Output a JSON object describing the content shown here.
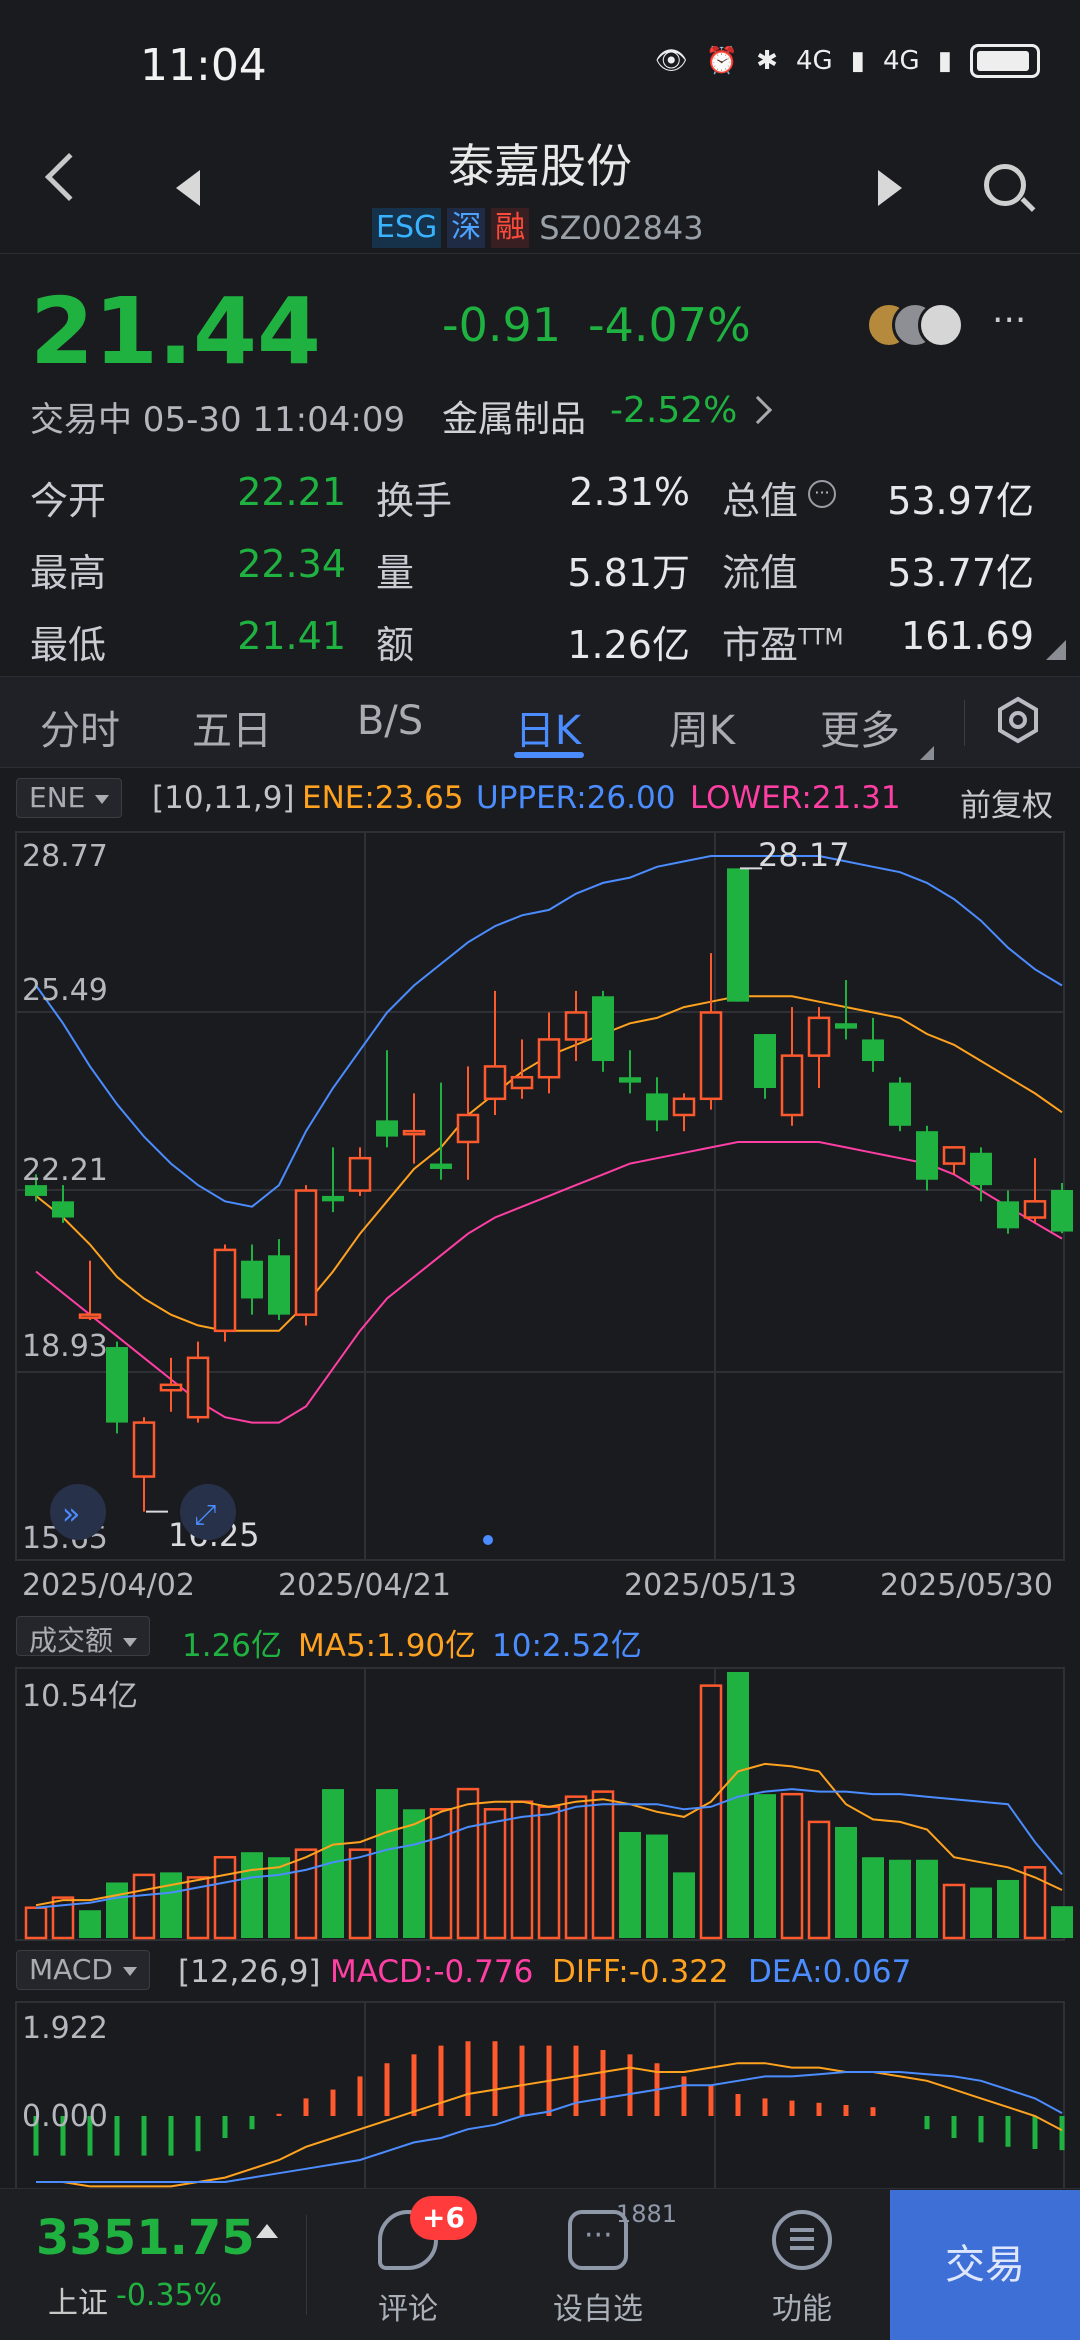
{
  "status_bar": {
    "time": "11:04",
    "net1": "4G",
    "net2": "4G"
  },
  "header": {
    "title": "泰嘉股份",
    "badges": [
      "ESG",
      "深",
      "融"
    ],
    "code": "SZ002843"
  },
  "quote": {
    "price": "21.44",
    "change": "-0.91",
    "change_pct": "-4.07%",
    "status": "交易中 05-30 11:04:09",
    "industry": "金属制品",
    "industry_change": "-2.52%",
    "more": "···"
  },
  "stats": [
    [
      {
        "label": "今开",
        "value": "22.21"
      },
      {
        "label": "换手",
        "value": "2.31%"
      },
      {
        "label": "总值",
        "value": "53.97亿"
      }
    ],
    [
      {
        "label": "最高",
        "value": "22.34"
      },
      {
        "label": "量",
        "value": "5.81万"
      },
      {
        "label": "流值",
        "value": "53.77亿"
      }
    ],
    [
      {
        "label": "最低",
        "value": "21.41"
      },
      {
        "label": "额",
        "value": "1.26亿"
      },
      {
        "label": "市盈",
        "value": "161.69",
        "sup": "TTM"
      }
    ]
  ],
  "tabs": [
    "分时",
    "五日",
    "B/S",
    "日K",
    "周K",
    "更多"
  ],
  "active_tab": "日K",
  "kline": {
    "indicator_select": "ENE",
    "params": "[10,11,9]",
    "ene": "ENE:23.65",
    "upper": "UPPER:26.00",
    "lower": "LOWER:21.31",
    "adjust": "前复权",
    "y_labels": [
      "28.77",
      "25.49",
      "22.21",
      "18.93",
      "15.65"
    ],
    "high_label": "28.17",
    "low_label": "16.25",
    "dates": [
      "2025/04/02",
      "2025/04/21",
      "2025/05/13",
      "2025/05/30"
    ]
  },
  "volume": {
    "select": "成交额",
    "value": "1.26亿",
    "ma5": "MA5:1.90亿",
    "ma10": "10:2.52亿",
    "y_max": "10.54亿"
  },
  "macd": {
    "select": "MACD",
    "params": "[12,26,9]",
    "macd": "MACD:-0.776",
    "diff": "DIFF:-0.322",
    "dea": "DEA:0.067",
    "y_labels": [
      "1.922",
      "0.000"
    ]
  },
  "bottom": {
    "index_value": "3351.75",
    "index_name": "上证",
    "index_change": "-0.35%",
    "comments_badge": "+6",
    "comments": "评论",
    "favorite_count": "1881",
    "favorite": "设自选",
    "functions": "功能",
    "trade": "交易"
  },
  "colors": {
    "up": "#ff5a2d",
    "down": "#20b241",
    "ene": "#ffa21f",
    "upper": "#4b8cff",
    "lower": "#ff3fa4",
    "accent": "#4b8cff"
  },
  "chart_data": [
    {
      "type": "candlestick",
      "title": "日K",
      "dates_shown": [
        "2025/04/02",
        "2025/04/21",
        "2025/05/13",
        "2025/05/30"
      ],
      "ylim": [
        15.65,
        28.77
      ],
      "candles": [
        {
          "o": 22.3,
          "c": 22.1,
          "h": 22.5,
          "l": 22.0
        },
        {
          "o": 22.0,
          "c": 21.7,
          "h": 22.3,
          "l": 21.6
        },
        {
          "o": 19.9,
          "c": 19.9,
          "h": 20.9,
          "l": 19.8
        },
        {
          "o": 19.3,
          "c": 17.9,
          "h": 19.4,
          "l": 17.7
        },
        {
          "o": 16.9,
          "c": 17.9,
          "h": 18.0,
          "l": 16.25
        },
        {
          "o": 18.5,
          "c": 18.6,
          "h": 19.1,
          "l": 18.1
        },
        {
          "o": 18.0,
          "c": 19.1,
          "h": 19.4,
          "l": 17.9
        },
        {
          "o": 19.6,
          "c": 21.1,
          "h": 21.2,
          "l": 19.4
        },
        {
          "o": 20.9,
          "c": 20.2,
          "h": 21.2,
          "l": 19.9
        },
        {
          "o": 21.0,
          "c": 19.9,
          "h": 21.3,
          "l": 19.8
        },
        {
          "o": 19.9,
          "c": 22.2,
          "h": 22.3,
          "l": 19.7
        },
        {
          "o": 22.1,
          "c": 22.0,
          "h": 23.0,
          "l": 21.8
        },
        {
          "o": 22.2,
          "c": 22.8,
          "h": 23.0,
          "l": 22.1
        },
        {
          "o": 23.5,
          "c": 23.2,
          "h": 24.8,
          "l": 23.0
        },
        {
          "o": 23.3,
          "c": 23.3,
          "h": 24.0,
          "l": 22.7
        },
        {
          "o": 22.7,
          "c": 22.6,
          "h": 24.2,
          "l": 22.4
        },
        {
          "o": 23.1,
          "c": 23.6,
          "h": 24.5,
          "l": 22.4
        },
        {
          "o": 23.9,
          "c": 24.5,
          "h": 25.9,
          "l": 23.6
        },
        {
          "o": 24.1,
          "c": 24.3,
          "h": 25.0,
          "l": 23.9
        },
        {
          "o": 24.3,
          "c": 25.0,
          "h": 25.5,
          "l": 24.0
        },
        {
          "o": 25.0,
          "c": 25.5,
          "h": 25.9,
          "l": 24.6
        },
        {
          "o": 25.8,
          "c": 24.6,
          "h": 25.9,
          "l": 24.4
        },
        {
          "o": 24.3,
          "c": 24.2,
          "h": 24.8,
          "l": 24.0
        },
        {
          "o": 24.0,
          "c": 23.5,
          "h": 24.3,
          "l": 23.3
        },
        {
          "o": 23.6,
          "c": 23.9,
          "h": 24.0,
          "l": 23.3
        },
        {
          "o": 23.9,
          "c": 25.5,
          "h": 26.6,
          "l": 23.7
        },
        {
          "o": 28.17,
          "c": 25.7,
          "h": 28.17,
          "l": 25.7
        },
        {
          "o": 25.1,
          "c": 24.1,
          "h": 25.1,
          "l": 23.9
        },
        {
          "o": 23.6,
          "c": 24.7,
          "h": 25.6,
          "l": 23.4
        },
        {
          "o": 24.7,
          "c": 25.4,
          "h": 25.6,
          "l": 24.1
        },
        {
          "o": 25.3,
          "c": 25.2,
          "h": 26.1,
          "l": 25.0
        },
        {
          "o": 25.0,
          "c": 24.6,
          "h": 25.4,
          "l": 24.4
        },
        {
          "o": 24.2,
          "c": 23.4,
          "h": 24.3,
          "l": 23.3
        },
        {
          "o": 23.3,
          "c": 22.4,
          "h": 23.4,
          "l": 22.2
        },
        {
          "o": 22.7,
          "c": 23.0,
          "h": 23.0,
          "l": 22.5
        },
        {
          "o": 22.9,
          "c": 22.3,
          "h": 23.0,
          "l": 22.0
        },
        {
          "o": 22.0,
          "c": 21.5,
          "h": 22.2,
          "l": 21.4
        },
        {
          "o": 21.7,
          "c": 22.0,
          "h": 22.8,
          "l": 21.6
        },
        {
          "o": 22.21,
          "c": 21.44,
          "h": 22.34,
          "l": 21.41
        }
      ],
      "ene_upper": [
        26.0,
        25.3,
        24.5,
        23.8,
        23.2,
        22.7,
        22.3,
        22.0,
        21.9,
        22.3,
        23.3,
        24.1,
        24.8,
        25.5,
        26.0,
        26.4,
        26.8,
        27.1,
        27.3,
        27.4,
        27.7,
        27.9,
        28.0,
        28.2,
        28.3,
        28.4,
        28.4,
        28.4,
        28.4,
        28.4,
        28.3,
        28.2,
        28.1,
        27.9,
        27.6,
        27.2,
        26.7,
        26.3,
        26.0
      ],
      "ene_mid": [
        22.1,
        21.7,
        21.2,
        20.6,
        20.2,
        19.9,
        19.7,
        19.6,
        19.6,
        19.6,
        20.1,
        20.7,
        21.4,
        22.0,
        22.6,
        23.0,
        23.6,
        24.0,
        24.4,
        24.7,
        24.9,
        25.1,
        25.3,
        25.4,
        25.6,
        25.7,
        25.8,
        25.8,
        25.8,
        25.7,
        25.6,
        25.5,
        25.4,
        25.1,
        24.9,
        24.6,
        24.3,
        24.0,
        23.65
      ],
      "ene_lower": [
        20.7,
        20.3,
        19.9,
        19.5,
        19.1,
        18.7,
        18.3,
        18.0,
        17.9,
        17.9,
        18.2,
        18.9,
        19.6,
        20.2,
        20.6,
        21.0,
        21.4,
        21.7,
        21.9,
        22.1,
        22.3,
        22.5,
        22.7,
        22.8,
        22.9,
        23.0,
        23.1,
        23.1,
        23.1,
        23.1,
        23.0,
        22.9,
        22.8,
        22.7,
        22.5,
        22.2,
        21.9,
        21.6,
        21.31
      ]
    },
    {
      "type": "bar",
      "title": "成交额",
      "ylim": [
        0,
        10.54
      ],
      "values": [
        1.2,
        1.6,
        1.1,
        2.2,
        2.5,
        2.6,
        2.4,
        3.2,
        3.4,
        3.2,
        3.5,
        5.9,
        3.5,
        5.9,
        5.1,
        5.1,
        5.9,
        5.1,
        5.4,
        5.2,
        5.6,
        5.8,
        4.2,
        4.1,
        2.6,
        10.0,
        10.54,
        5.7,
        5.7,
        4.6,
        4.4,
        3.2,
        3.1,
        3.1,
        2.1,
        2.0,
        2.3,
        2.8,
        1.26
      ],
      "up": [
        true,
        true,
        false,
        false,
        true,
        false,
        true,
        true,
        false,
        false,
        true,
        false,
        true,
        false,
        false,
        true,
        true,
        true,
        true,
        true,
        true,
        true,
        false,
        false,
        false,
        true,
        false,
        false,
        true,
        true,
        false,
        false,
        false,
        false,
        true,
        false,
        false,
        true,
        false
      ],
      "ma5": [
        1.3,
        1.5,
        1.5,
        1.7,
        1.9,
        2.1,
        2.3,
        2.5,
        2.7,
        2.8,
        3.2,
        3.7,
        3.8,
        4.2,
        4.5,
        5.0,
        5.3,
        5.4,
        5.4,
        5.2,
        5.4,
        5.5,
        5.3,
        5.0,
        4.8,
        5.4,
        6.6,
        6.9,
        6.8,
        6.6,
        5.3,
        4.7,
        4.6,
        4.3,
        3.2,
        3.0,
        2.8,
        2.4,
        1.9
      ],
      "ma10": [
        1.2,
        1.3,
        1.4,
        1.6,
        1.7,
        1.8,
        2.0,
        2.2,
        2.4,
        2.5,
        2.7,
        3.0,
        3.2,
        3.5,
        3.7,
        4.0,
        4.4,
        4.6,
        4.8,
        4.9,
        5.2,
        5.3,
        5.3,
        5.3,
        5.1,
        5.2,
        5.6,
        5.8,
        5.9,
        5.8,
        5.8,
        5.7,
        5.7,
        5.6,
        5.5,
        5.4,
        5.3,
        3.8,
        2.52
      ]
    },
    {
      "type": "bar",
      "title": "MACD",
      "ylim": [
        -1.0,
        1.922
      ],
      "macd": [
        -0.9,
        -0.9,
        -0.9,
        -0.9,
        -0.9,
        -0.9,
        -0.8,
        -0.5,
        -0.3,
        0.05,
        0.4,
        0.6,
        0.9,
        1.2,
        1.4,
        1.6,
        1.7,
        1.7,
        1.6,
        1.6,
        1.6,
        1.5,
        1.4,
        1.2,
        0.9,
        0.7,
        0.5,
        0.4,
        0.35,
        0.3,
        0.25,
        0.2,
        0.0,
        -0.3,
        -0.5,
        -0.6,
        -0.7,
        -0.75,
        -0.776
      ],
      "diff": [
        -1.5,
        -1.5,
        -1.6,
        -1.6,
        -1.6,
        -1.6,
        -1.5,
        -1.4,
        -1.2,
        -1.0,
        -0.7,
        -0.5,
        -0.3,
        -0.1,
        0.1,
        0.3,
        0.5,
        0.6,
        0.7,
        0.8,
        0.9,
        1.0,
        1.1,
        1.0,
        1.0,
        1.1,
        1.2,
        1.2,
        1.1,
        1.1,
        1.0,
        1.0,
        0.9,
        0.8,
        0.6,
        0.4,
        0.2,
        0.0,
        -0.322
      ],
      "dea": [
        -1.5,
        -1.5,
        -1.5,
        -1.5,
        -1.5,
        -1.5,
        -1.5,
        -1.5,
        -1.4,
        -1.3,
        -1.2,
        -1.1,
        -1.0,
        -0.8,
        -0.6,
        -0.5,
        -0.3,
        -0.2,
        0.0,
        0.1,
        0.3,
        0.4,
        0.5,
        0.6,
        0.7,
        0.7,
        0.8,
        0.9,
        0.9,
        0.95,
        1.0,
        1.0,
        1.0,
        0.95,
        0.9,
        0.8,
        0.6,
        0.4,
        0.067
      ]
    }
  ]
}
